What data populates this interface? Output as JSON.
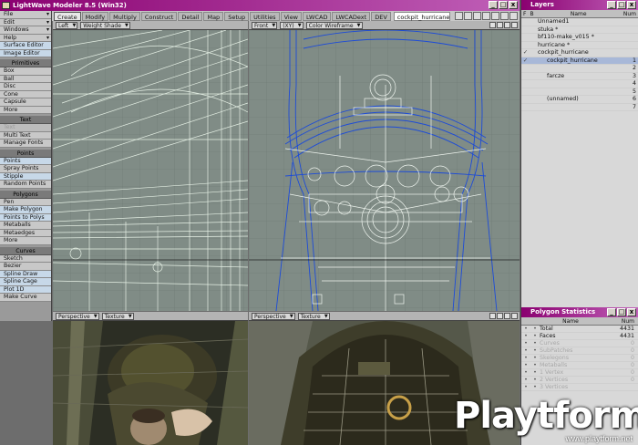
{
  "window": {
    "title": "LightWave Modeler 8.5 (Win32)",
    "btn_min": "_",
    "btn_max": "□",
    "btn_close": "x"
  },
  "tabs": [
    "Create",
    "Modify",
    "Multiply",
    "Construct",
    "Detail",
    "Map",
    "Setup",
    "Utilities",
    "View",
    "LWCAD",
    "LWCADext",
    "DEV"
  ],
  "layer_selector": "cockpit_hurricane",
  "toolbar": {
    "top": [
      {
        "label": "File",
        "dd": "▾"
      },
      {
        "label": "Edit",
        "dd": "▾"
      },
      {
        "label": "Windows",
        "dd": "▾"
      },
      {
        "label": "Help",
        "dd": "▾"
      },
      {
        "label": "Surface Editor"
      },
      {
        "label": "Image Editor"
      }
    ],
    "sections": [
      {
        "title": "Primitives",
        "items": [
          "Box",
          "Ball",
          "Disc",
          "Cone",
          "Capsule",
          "More"
        ]
      },
      {
        "title": "Text",
        "items": [
          "Text",
          "Multi Text",
          "Manage Fonts"
        ]
      },
      {
        "title": "Points",
        "items": [
          "Points",
          "Spray Points",
          "Stipple",
          "Random Points"
        ]
      },
      {
        "title": "Polygons",
        "items": [
          "Pen",
          "Make Polygon",
          "Points to Polys",
          "Metaballs",
          "Metaedges",
          "More"
        ]
      },
      {
        "title": "Curves",
        "items": [
          "Sketch",
          "Bezier",
          "Spline Draw",
          "Spline Cage",
          "Plot 1D",
          "Make Curve"
        ]
      }
    ]
  },
  "viewports": {
    "top_left": {
      "view": "Left",
      "mode": "Weight Shade"
    },
    "top_right": {
      "view": "Front",
      "mode": "Color Wireframe",
      "extra": "(XY)"
    },
    "bottom_left": {
      "view": "Perspective",
      "mode": "Texture"
    },
    "bottom_right": {
      "view": "Perspective",
      "mode": "Texture"
    }
  },
  "layers": {
    "title": "Layers",
    "headers": {
      "f": "F",
      "b": "B",
      "name": "Name",
      "num": "Num"
    },
    "rows": [
      {
        "check": "",
        "name": "Unnamed1",
        "num": "",
        "indent": 0
      },
      {
        "check": "",
        "name": "stuka *",
        "num": "",
        "indent": 0
      },
      {
        "check": "",
        "name": "bf110-make_v015 *",
        "num": "",
        "indent": 0
      },
      {
        "check": "",
        "name": "hurricane *",
        "num": "",
        "indent": 0
      },
      {
        "check": "✓",
        "name": "cockpit_hurricane",
        "num": "",
        "indent": 0
      },
      {
        "check": "✓",
        "name": "cockpit_hurricane",
        "num": "1",
        "indent": 1,
        "hl": true
      },
      {
        "check": "",
        "name": "",
        "num": "2",
        "indent": 1
      },
      {
        "check": "",
        "name": "farcze",
        "num": "3",
        "indent": 1
      },
      {
        "check": "",
        "name": "",
        "num": "4",
        "indent": 1
      },
      {
        "check": "",
        "name": "",
        "num": "5",
        "indent": 1
      },
      {
        "check": "",
        "name": "(unnamed)",
        "num": "6",
        "indent": 1
      },
      {
        "check": "",
        "name": "",
        "num": "7",
        "indent": 1
      }
    ]
  },
  "stats": {
    "title": "Polygon Statistics",
    "headers": {
      "name": "Name",
      "num": "Num"
    },
    "rows": [
      {
        "name": "Total",
        "num": "4431",
        "dim": false
      },
      {
        "name": "Faces",
        "num": "4431",
        "dim": false
      },
      {
        "name": "Curves",
        "num": "0",
        "dim": true
      },
      {
        "name": "SubPatches",
        "num": "0",
        "dim": true
      },
      {
        "name": "Skelegons",
        "num": "0",
        "dim": true
      },
      {
        "name": "Metaballs",
        "num": "0",
        "dim": true
      },
      {
        "name": "1 Vertex",
        "num": "0",
        "dim": true
      },
      {
        "name": "2 Vertices",
        "num": "0",
        "dim": true
      },
      {
        "name": "3 Vertices",
        "num": "",
        "dim": true
      }
    ]
  },
  "watermark": {
    "logo": "Playtform",
    "url": "www.playtform.net"
  }
}
